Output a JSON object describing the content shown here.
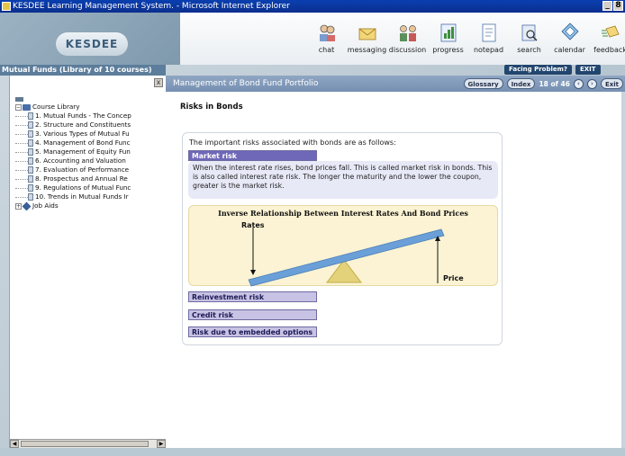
{
  "window": {
    "title": "KESDEE Learning Management System. - Microsoft Internet Explorer",
    "controls": [
      "_",
      "8"
    ]
  },
  "header": {
    "logo": "KESDEE",
    "tools": [
      {
        "label": "chat",
        "icon": "chat-icon"
      },
      {
        "label": "messaging",
        "icon": "envelope-icon"
      },
      {
        "label": "discussion",
        "icon": "discussion-icon"
      },
      {
        "label": "progress",
        "icon": "progress-icon"
      },
      {
        "label": "notepad",
        "icon": "notepad-icon"
      },
      {
        "label": "search",
        "icon": "search-icon"
      },
      {
        "label": "calendar",
        "icon": "calendar-icon"
      },
      {
        "label": "feedback",
        "icon": "feedback-icon"
      }
    ]
  },
  "sidebar": {
    "title": "Mutual Funds (Library of 10 courses)",
    "close": "x",
    "library": "Course Library",
    "courses": [
      "1. Mutual Funds - The Concep",
      "2. Structure and Constituents",
      "3. Various Types of Mutual Fu",
      "4. Management of Bond Func",
      "5. Management of Equity Fun",
      "6. Accounting and Valuation",
      "7. Evaluation of Performance",
      "8. Prospectus and Annual Re",
      "9. Regulations of Mutual Func",
      "10. Trends in Mutual Funds Ir"
    ],
    "job_aids": "Job Aids"
  },
  "topright": {
    "facing_problem": "Facing Problem?",
    "exit": "EXIT"
  },
  "module": {
    "title": "Management of Bond Fund Portfolio",
    "glossary": "Glossary",
    "index": "Index",
    "page": "18 of 46",
    "exit": "Exit"
  },
  "content": {
    "section_title": "Risks in Bonds",
    "intro": "The important risks associated with bonds are as follows:",
    "market_risk": {
      "header": "Market risk",
      "body": "When the interest rate rises, bond prices fall. This is called market risk in bonds. This is also called interest rate risk. The longer the maturity and the lower the coupon, greater is the market risk."
    },
    "diagram": {
      "title": "Inverse Relationship Between Interest Rates And Bond Prices",
      "left_label": "Rates",
      "right_label": "Price",
      "colors": {
        "beam": "#6b9fd8",
        "fulcrum": "#e3d27a"
      }
    },
    "other_risks": [
      "Reinvestment risk",
      "Credit risk",
      "Risk due to embedded options"
    ]
  }
}
